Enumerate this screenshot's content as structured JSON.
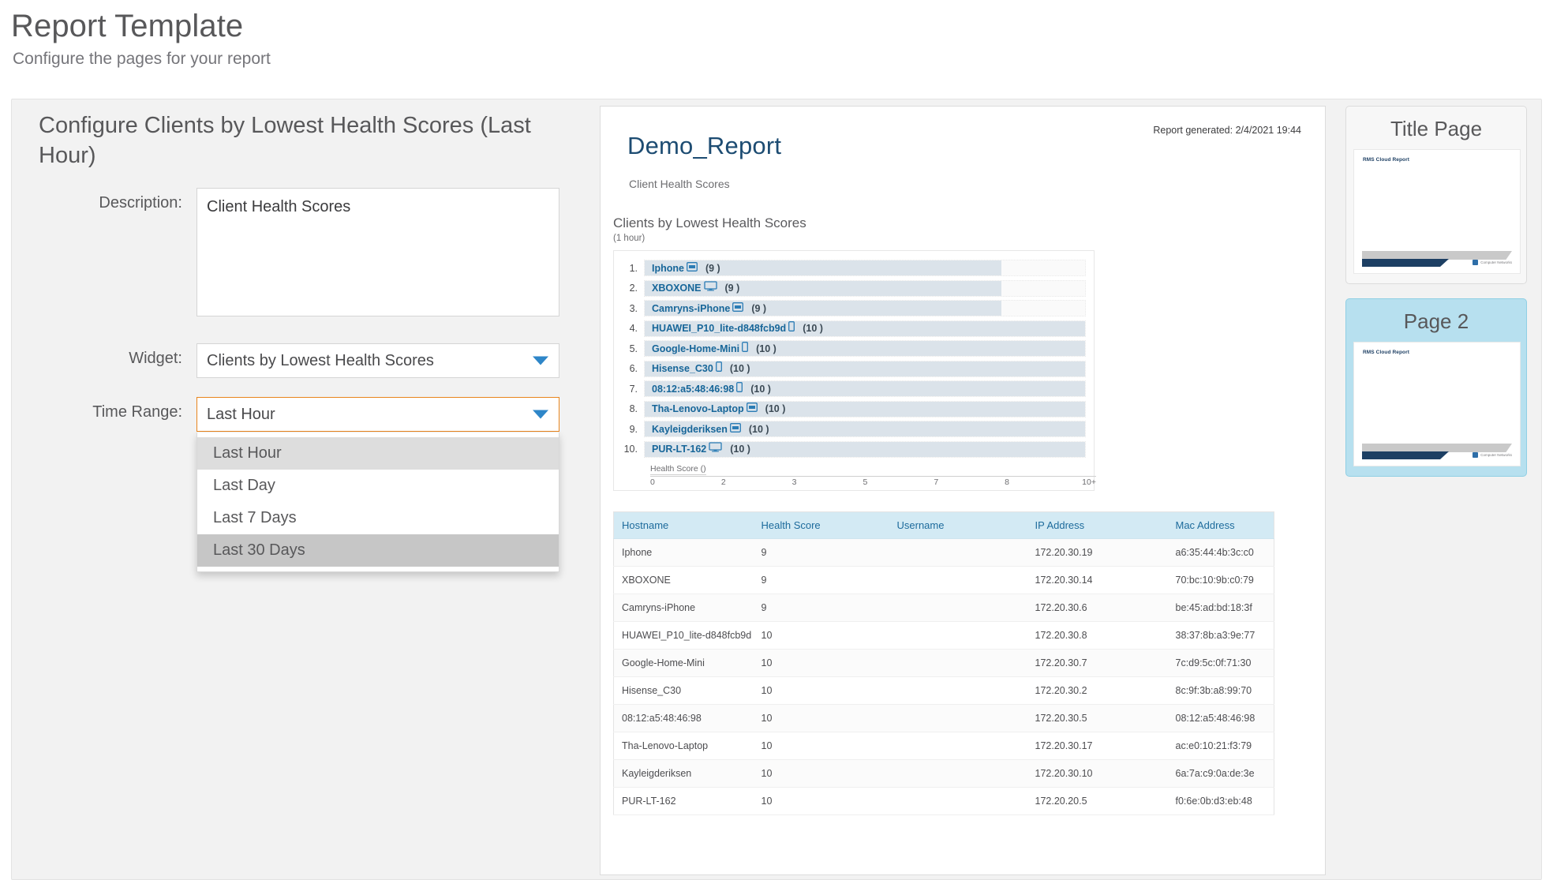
{
  "header": {
    "title": "Report Template",
    "subtitle": "Configure the pages for your report"
  },
  "config": {
    "heading": "Configure Clients by Lowest Health Scores (Last Hour)",
    "description_label": "Description:",
    "description_value": "Client Health Scores",
    "widget_label": "Widget:",
    "widget_value": "Clients by Lowest Health Scores",
    "time_range_label": "Time Range:",
    "time_range_value": "Last Hour",
    "time_range_options": [
      {
        "label": "Last Hour",
        "state": "selected"
      },
      {
        "label": "Last Day",
        "state": "normal"
      },
      {
        "label": "Last 7 Days",
        "state": "normal"
      },
      {
        "label": "Last 30 Days",
        "state": "hovered"
      }
    ]
  },
  "report": {
    "title": "Demo_Report",
    "generated": "Report generated: 2/4/2021 19:44",
    "subtitle": "Client Health Scores",
    "widget_title": "Clients by Lowest Health Scores",
    "widget_subtitle": "(1 hour)",
    "table": {
      "columns": [
        "Hostname",
        "Health Score",
        "Username",
        "IP Address",
        "Mac Address"
      ],
      "rows": [
        [
          "Iphone",
          "9",
          "",
          "172.20.30.19",
          "a6:35:44:4b:3c:c0"
        ],
        [
          "XBOXONE",
          "9",
          "",
          "172.20.30.14",
          "70:bc:10:9b:c0:79"
        ],
        [
          "Camryns-iPhone",
          "9",
          "",
          "172.20.30.6",
          "be:45:ad:bd:18:3f"
        ],
        [
          "HUAWEI_P10_lite-d848fcb9d",
          "10",
          "",
          "172.20.30.8",
          "38:37:8b:a3:9e:77"
        ],
        [
          "Google-Home-Mini",
          "10",
          "",
          "172.20.30.7",
          "7c:d9:5c:0f:71:30"
        ],
        [
          "Hisense_C30",
          "10",
          "",
          "172.20.30.2",
          "8c:9f:3b:a8:99:70"
        ],
        [
          "08:12:a5:48:46:98",
          "10",
          "",
          "172.20.30.5",
          "08:12:a5:48:46:98"
        ],
        [
          "Tha-Lenovo-Laptop",
          "10",
          "",
          "172.20.30.17",
          "ac:e0:10:21:f3:79"
        ],
        [
          "Kayleigderiksen",
          "10",
          "",
          "172.20.30.10",
          "6a:7a:c9:0a:de:3e"
        ],
        [
          "PUR-LT-162",
          "10",
          "",
          "172.20.20.5",
          "f0:6e:0b:d3:eb:48"
        ]
      ]
    }
  },
  "chart_data": {
    "type": "bar",
    "title": "Clients by Lowest Health Scores",
    "subtitle": "(1 hour)",
    "orientation": "horizontal",
    "xlabel": "Health Score ()",
    "ylabel": "",
    "grid": false,
    "legend": null,
    "xticks": [
      "0",
      "2",
      "3",
      "5",
      "7",
      "8",
      "10+"
    ],
    "xlim": [
      0,
      10
    ],
    "categories": [
      "Iphone",
      "XBOXONE",
      "Camryns-iPhone",
      "HUAWEI_P10_lite-d848fcb9d",
      "Google-Home-Mini",
      "Hisense_C30",
      "08:12:a5:48:46:98",
      "Tha-Lenovo-Laptop",
      "Kayleigderiksen",
      "PUR-LT-162"
    ],
    "values": [
      9,
      9,
      9,
      10,
      10,
      10,
      10,
      10,
      10,
      10
    ],
    "ranks": [
      "1.",
      "2.",
      "3.",
      "4.",
      "5.",
      "6.",
      "7.",
      "8.",
      "9.",
      "10."
    ],
    "value_labels": [
      "(9 )",
      "(9 )",
      "(9 )",
      "(10 )",
      "(10 )",
      "(10 )",
      "(10 )",
      "(10 )",
      "(10 )",
      "(10 )"
    ],
    "device_icons": [
      "tablet-icon",
      "monitor-icon",
      "tablet-icon",
      "phone-icon",
      "phone-icon",
      "phone-icon",
      "phone-icon",
      "tablet-icon",
      "tablet-icon",
      "monitor-icon"
    ],
    "bar_color": "#dbe3ea",
    "label_color": "#176699"
  },
  "thumbnails": [
    {
      "title": "Title Page",
      "page_header": "RMS Cloud Report",
      "logo_text": "Computer Networks",
      "active": false
    },
    {
      "title": "Page 2",
      "page_header": "RMS Cloud Report",
      "logo_text": "Computer Networks",
      "active": true
    }
  ]
}
